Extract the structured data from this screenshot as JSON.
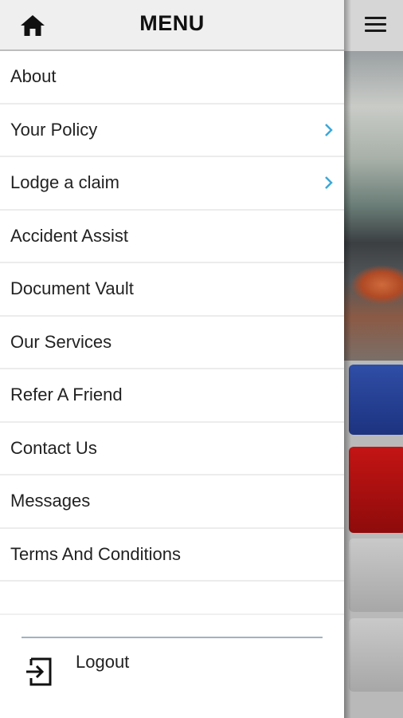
{
  "drawer": {
    "title": "MENU",
    "home_icon": "home-icon",
    "items": [
      {
        "label": "About",
        "chevron": false
      },
      {
        "label": "Your Policy",
        "chevron": true
      },
      {
        "label": "Lodge a claim",
        "chevron": true
      },
      {
        "label": "Accident Assist",
        "chevron": false
      },
      {
        "label": "Document Vault",
        "chevron": false
      },
      {
        "label": "Our Services",
        "chevron": false
      },
      {
        "label": "Refer A Friend",
        "chevron": false
      },
      {
        "label": "Contact Us",
        "chevron": false
      },
      {
        "label": "Messages",
        "chevron": false
      },
      {
        "label": "Terms And Conditions",
        "chevron": false
      }
    ],
    "logout_label": "Logout",
    "logout_icon": "logout-icon"
  },
  "background_app": {
    "menu_icon": "hamburger-menu-icon"
  },
  "colors": {
    "chevron": "#3aa8d8",
    "header_bg": "#efefef",
    "tile_blue": "#1d3380",
    "tile_red": "#c41414"
  }
}
